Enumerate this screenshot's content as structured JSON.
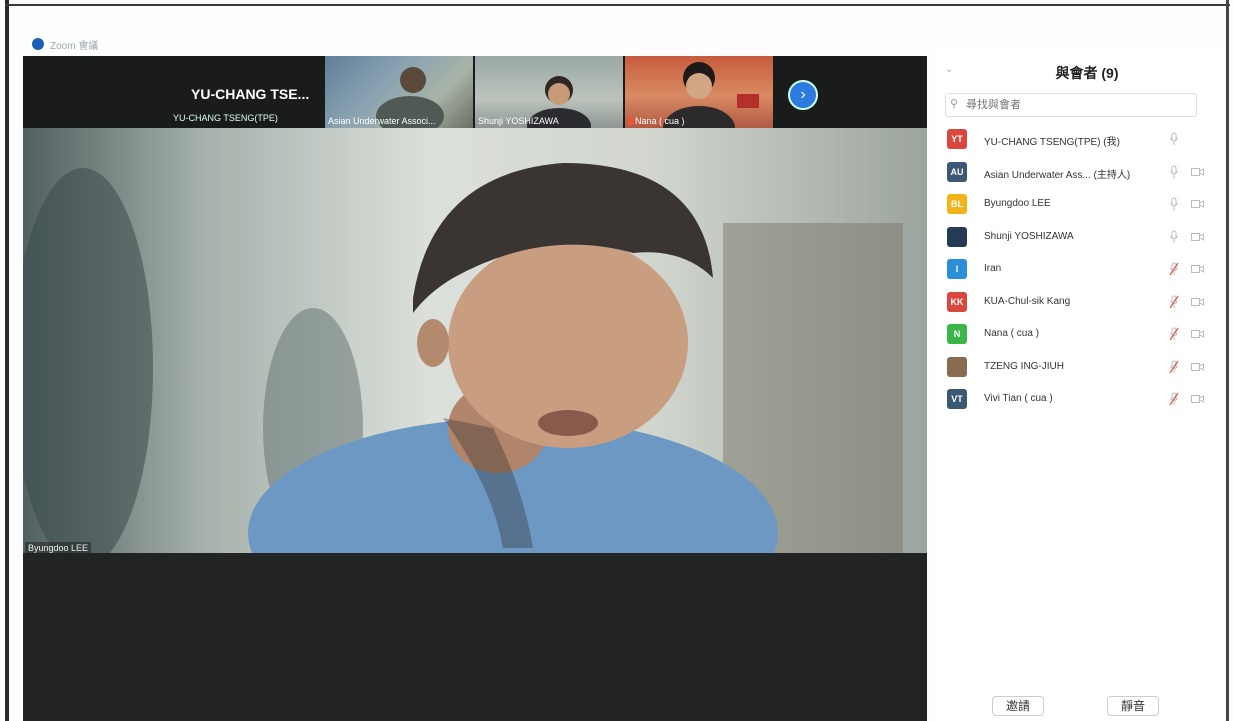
{
  "window": {
    "title": "Zoom 會議"
  },
  "strip": {
    "active_big_name": "YU-CHANG TSE...",
    "active_full_name": "YU-CHANG TSENG(TPE)",
    "thumbnails": [
      {
        "label": "Asian Underwater Associ..."
      },
      {
        "label": "Shunji YOSHIZAWA"
      },
      {
        "label": "Nana ( cua )"
      }
    ],
    "next_icon": "chevron-right-icon"
  },
  "main_video": {
    "speaker_label": "Byungdoo LEE"
  },
  "panel": {
    "title": "與會者 (9)",
    "search_placeholder": "尋找與會者",
    "participants": [
      {
        "initials": "YT",
        "name": "YU-CHANG TSENG(TPE) (我)",
        "color": "#d9473f",
        "muted": false,
        "video": false
      },
      {
        "initials": "AU",
        "name": "Asian Underwater Ass... (主持人)",
        "color": "#3a5773",
        "muted": false,
        "video": true
      },
      {
        "initials": "BL",
        "name": "Byungdoo LEE",
        "color": "#f0b419",
        "muted": false,
        "video": true
      },
      {
        "initials": "",
        "name": "Shunji YOSHIZAWA",
        "color": "#243a56",
        "muted": false,
        "video": true
      },
      {
        "initials": "I",
        "name": "Iran",
        "color": "#2a8ed8",
        "muted": true,
        "video": true
      },
      {
        "initials": "KK",
        "name": "KUA-Chul-sik Kang",
        "color": "#d9473f",
        "muted": true,
        "video": true
      },
      {
        "initials": "N",
        "name": "Nana ( cua )",
        "color": "#3bb54a",
        "muted": true,
        "video": true
      },
      {
        "initials": "",
        "name": "TZENG ING-JIUH",
        "color": "#8a6b50",
        "muted": true,
        "video": true
      },
      {
        "initials": "VT",
        "name": "Vivi Tian ( cua )",
        "color": "#3a5773",
        "muted": true,
        "video": true
      }
    ],
    "invite_label": "邀請",
    "mute_all_label": "靜音"
  }
}
